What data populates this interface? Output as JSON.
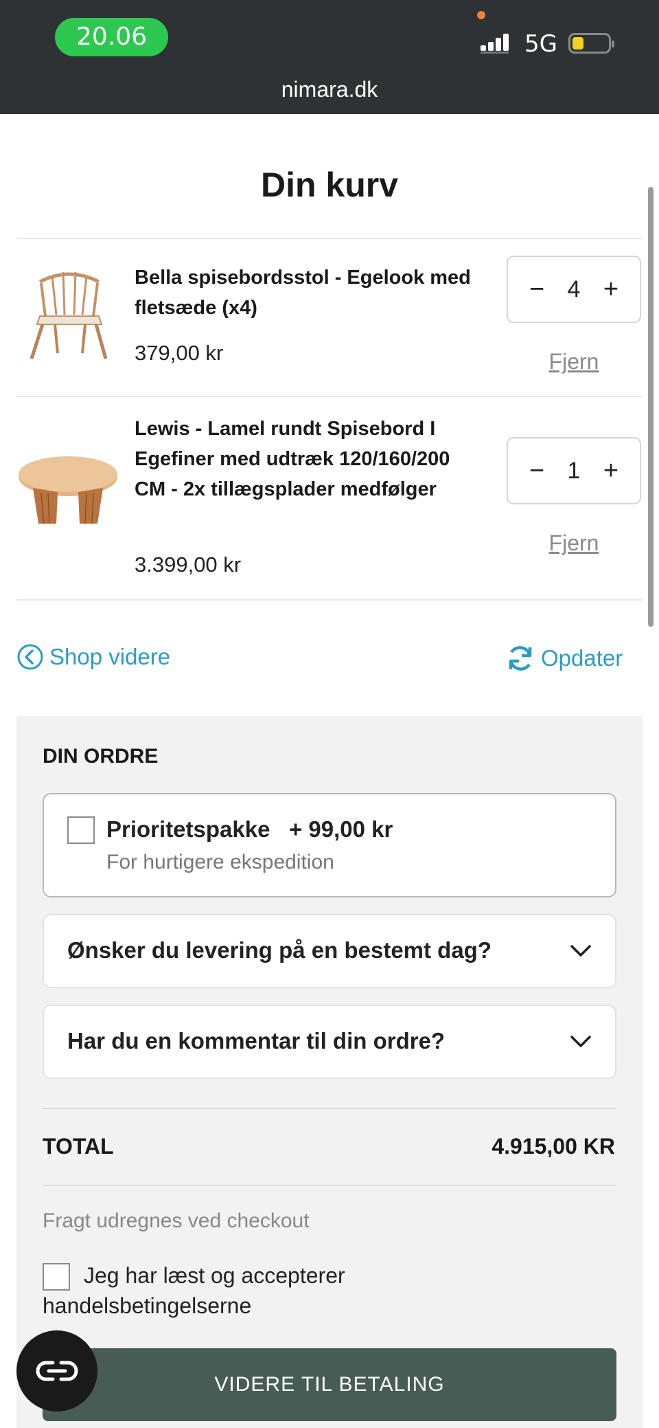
{
  "status_bar": {
    "time": "20.06",
    "network": "5G",
    "url": "nimara.dk"
  },
  "page": {
    "title": "Din kurv"
  },
  "cart_items": [
    {
      "name": "Bella spisebordsstol - Egelook med fletsæde (x4)",
      "price": "379,00 kr",
      "quantity": "4",
      "remove_label": "Fjern",
      "image_icon": "chair-icon"
    },
    {
      "name": "Lewis - Lamel rundt Spisebord I Egefiner med udtræk 120/160/200 CM - 2x tillægsplader medfølger",
      "price": "3.399,00 kr",
      "quantity": "1",
      "remove_label": "Fjern",
      "image_icon": "table-icon"
    }
  ],
  "actions": {
    "shop_more": "Shop videre",
    "update": "Opdater"
  },
  "order": {
    "heading": "DIN ORDRE",
    "priority": {
      "title": "Prioritetspakke",
      "price": "+ 99,00 kr",
      "subtitle": "For hurtigere ekspedition",
      "checked": false
    },
    "delivery_question": "Ønsker du levering på en bestemt dag?",
    "comment_question": "Har du en kommentar til din ordre?",
    "total_label": "TOTAL",
    "total_value": "4.915,00 KR",
    "freight_note": "Fragt udregnes ved checkout",
    "terms_label": "Jeg har læst og accepterer handelsbetingelserne",
    "terms_checked": false,
    "pay_button": "VIDERE TIL BETALING"
  },
  "colors": {
    "accent": "#2d9bc4",
    "pay_button": "#465c55",
    "status_bar": "#2f3235",
    "time_pill": "#2cc84f"
  }
}
